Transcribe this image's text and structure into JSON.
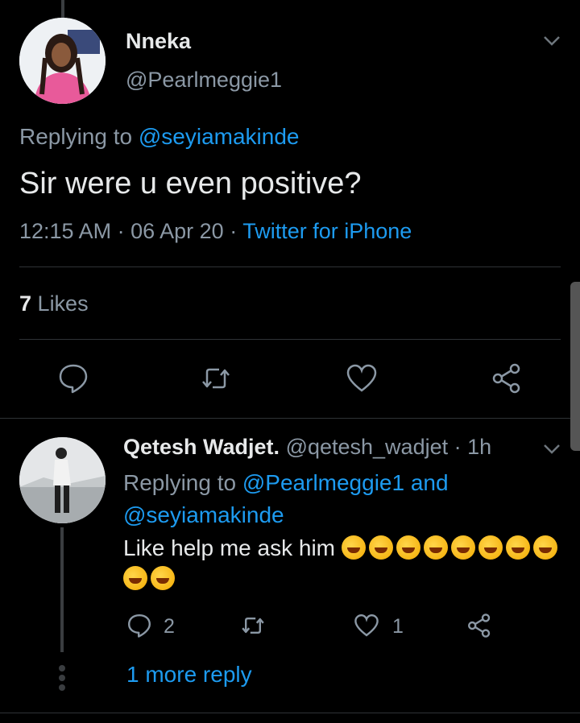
{
  "tweet": {
    "author_name": "Nneka",
    "author_handle": "@Pearlmeggie1",
    "replying_prefix": "Replying to",
    "replying_to": "@seyiamakinde",
    "text": "Sir were u even positive?",
    "time": "12:15 AM",
    "date": "06 Apr 20",
    "separator": "·",
    "source": "Twitter for iPhone",
    "likes_count": "7",
    "likes_label": "Likes",
    "icons": [
      "comment-icon",
      "retweet-icon",
      "like-icon",
      "share-icon",
      "chevron-down-icon"
    ]
  },
  "reply": {
    "author_name": "Qetesh Wadjet.",
    "author_handle": "@qetesh_wadjet",
    "separator": "·",
    "age": "1h",
    "replying_prefix": "Replying to",
    "replying_to_1": "@Pearlmeggie1",
    "and": "and",
    "replying_to_2": "@seyiamakinde",
    "text": "Like help me ask him",
    "emoji_count": 10,
    "comment_count": "2",
    "like_count": "1"
  },
  "more_reply_label": "1 more reply",
  "colors": {
    "background": "#000000",
    "link": "#1d9bf0",
    "secondary_text": "#8b98a5",
    "primary_text": "#e7e9ea",
    "divider": "#2f3336"
  }
}
